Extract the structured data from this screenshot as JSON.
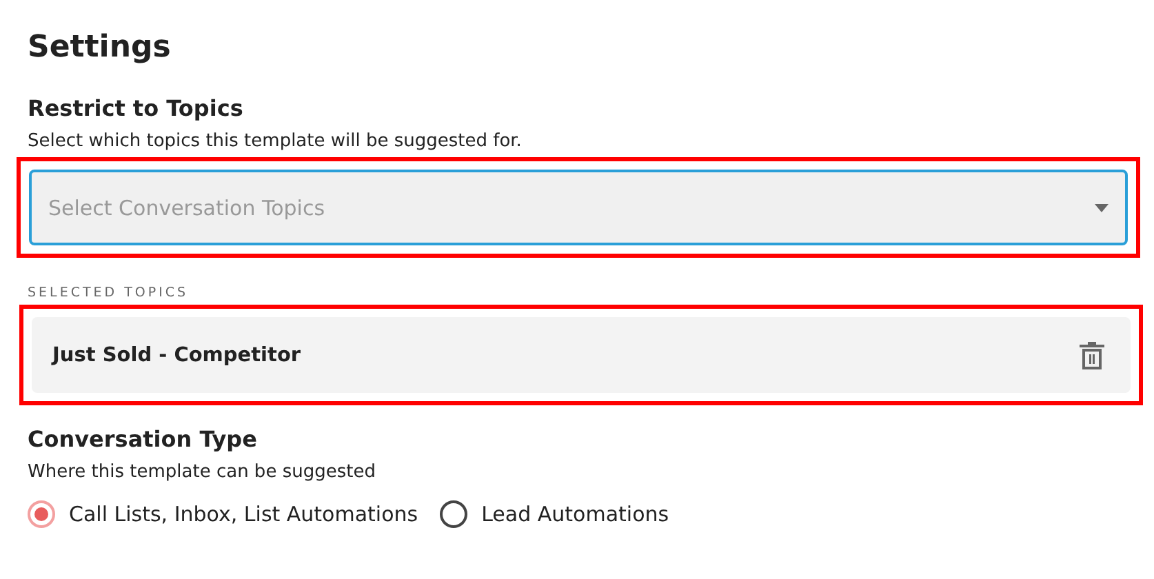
{
  "title": "Settings",
  "topics_section": {
    "heading": "Restrict to Topics",
    "description": "Select which topics this template will be suggested for.",
    "select": {
      "placeholder": "Select Conversation Topics",
      "focused": true
    },
    "highlighted": true
  },
  "selected_topics": {
    "label": "SELECTED TOPICS",
    "highlighted": true,
    "items": [
      {
        "name": "Just Sold - Competitor"
      }
    ]
  },
  "conversation_type": {
    "heading": "Conversation Type",
    "description": "Where this template can be suggested",
    "options": [
      {
        "label": "Call Lists, Inbox, List Automations",
        "selected": true
      },
      {
        "label": "Lead Automations",
        "selected": false
      }
    ]
  }
}
